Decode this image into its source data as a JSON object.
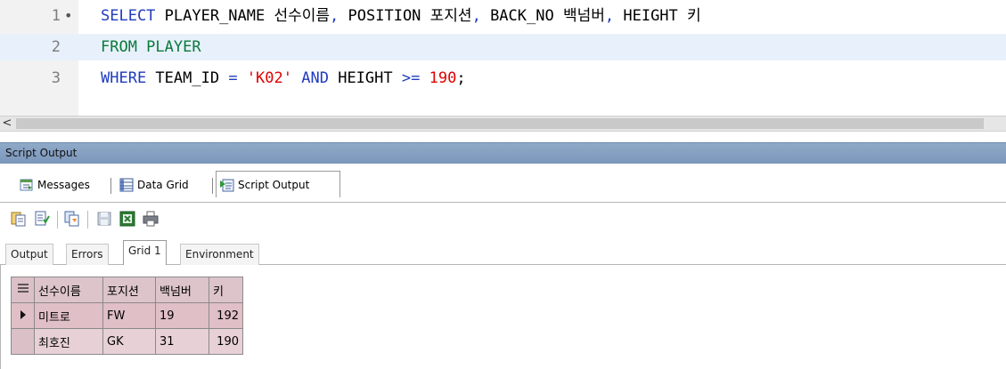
{
  "editor": {
    "lines": [
      {
        "number": "1",
        "marker": "•",
        "tokens": [
          {
            "t": "SELECT",
            "c": "kw"
          },
          {
            "t": " PLAYER_NAME 선수이름",
            "c": ""
          },
          {
            "t": ",",
            "c": "kw"
          },
          {
            "t": " POSITION 포지션",
            "c": ""
          },
          {
            "t": ",",
            "c": "kw"
          },
          {
            "t": " BACK_NO 백넘버",
            "c": ""
          },
          {
            "t": ",",
            "c": "kw"
          },
          {
            "t": " HEIGHT 키",
            "c": ""
          }
        ]
      },
      {
        "number": "2",
        "marker": "",
        "tokens": [
          {
            "t": "FROM PLAYER",
            "c": "kw2"
          }
        ]
      },
      {
        "number": "3",
        "marker": "",
        "tokens": [
          {
            "t": "WHERE",
            "c": "kw"
          },
          {
            "t": " TEAM_ID ",
            "c": ""
          },
          {
            "t": "=",
            "c": "kw"
          },
          {
            "t": " ",
            "c": ""
          },
          {
            "t": "'K02'",
            "c": "str"
          },
          {
            "t": " ",
            "c": ""
          },
          {
            "t": "AND",
            "c": "kw"
          },
          {
            "t": " HEIGHT ",
            "c": ""
          },
          {
            "t": ">=",
            "c": "kw"
          },
          {
            "t": " ",
            "c": ""
          },
          {
            "t": "190",
            "c": "num"
          },
          {
            "t": ";",
            "c": ""
          }
        ]
      }
    ],
    "scroll_left_glyph": "<"
  },
  "panel": {
    "title": "Script Output",
    "tabs": {
      "messages": "Messages",
      "data_grid": "Data Grid",
      "script_output": "Script Output"
    }
  },
  "toolbar_icons": [
    "freeze-view-icon",
    "sql-icon",
    "copy-icon",
    "save-icon",
    "excel-icon",
    "print-icon"
  ],
  "result_tabs": {
    "output": "Output",
    "errors": "Errors",
    "grid1": "Grid 1",
    "environment": "Environment"
  },
  "grid": {
    "headers": [
      "선수이름",
      "포지션",
      "백넘버",
      "키"
    ],
    "rows": [
      {
        "selected": true,
        "cells": [
          "미트로",
          "FW",
          "19",
          "192"
        ]
      },
      {
        "selected": false,
        "cells": [
          "최호진",
          "GK",
          "31",
          "190"
        ]
      }
    ]
  },
  "colors": {
    "keyword": "#1f3bbf",
    "keyword_from": "#0b7a3a",
    "literal": "#e00000",
    "panel_title_bg": "#8fa9c8",
    "grid_bg": "#e7d1d6"
  }
}
